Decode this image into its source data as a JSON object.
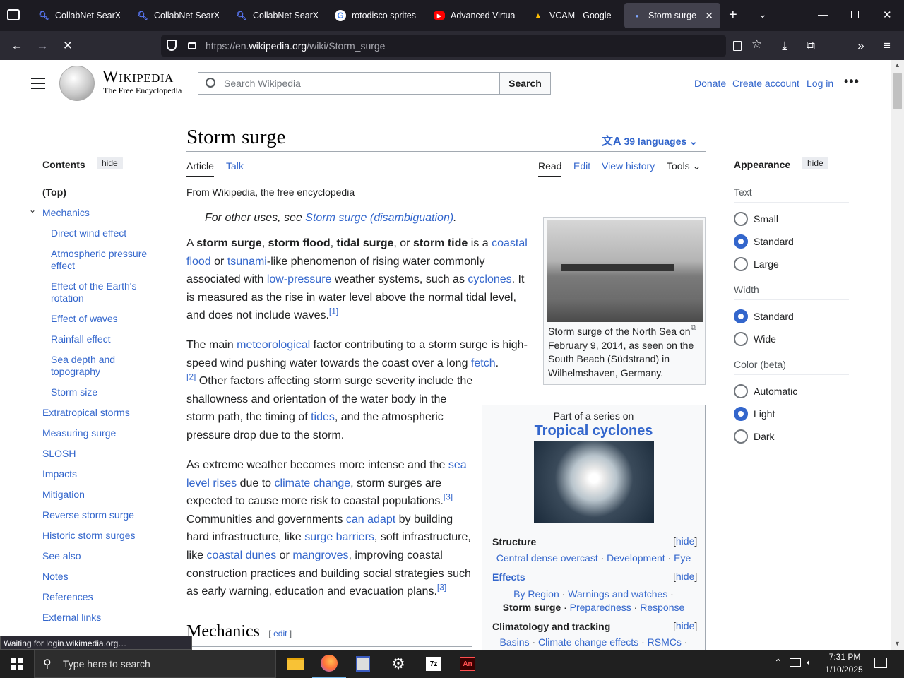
{
  "tabs": [
    {
      "title": "CollabNet SearXNG",
      "icon": "search-icon"
    },
    {
      "title": "CollabNet SearXNG",
      "icon": "search-icon"
    },
    {
      "title": "CollabNet SearXNG",
      "icon": "search-icon"
    },
    {
      "title": "rotodisco sprites s",
      "icon": "google-icon"
    },
    {
      "title": "Advanced Virtual C",
      "icon": "youtube-icon"
    },
    {
      "title": "VCAM - Google Dr",
      "icon": "google-drive-icon"
    },
    {
      "title": "Storm surge - W",
      "icon": "loading-icon"
    }
  ],
  "url": {
    "prefix": "https://en.",
    "domain": "wikipedia.org",
    "path": "/wiki/Storm_surge"
  },
  "status_text": "Waiting for login.wikimedia.org…",
  "wiki": {
    "logo_title": "Wikipedia",
    "logo_tagline": "The Free Encyclopedia",
    "search_placeholder": "Search Wikipedia",
    "search_button": "Search",
    "header_links": [
      "Donate",
      "Create account",
      "Log in"
    ],
    "title": "Storm surge",
    "languages": "39 languages",
    "tabs_left": [
      "Article",
      "Talk"
    ],
    "tabs_right": [
      "Read",
      "Edit",
      "View history",
      "Tools"
    ],
    "from": "From Wikipedia, the free encyclopedia",
    "hatnote_prefix": "For other uses, see ",
    "hatnote_link": "Storm surge (disambiguation)",
    "hatnote_suffix": ".",
    "contents_title": "Contents",
    "hide": "hide",
    "contents": [
      {
        "label": "(Top)",
        "level": 0
      },
      {
        "label": "Mechanics",
        "level": 0
      },
      {
        "label": "Direct wind effect",
        "level": 1
      },
      {
        "label": "Atmospheric pressure effect",
        "level": 1
      },
      {
        "label": "Effect of the Earth's rotation",
        "level": 1
      },
      {
        "label": "Effect of waves",
        "level": 1
      },
      {
        "label": "Rainfall effect",
        "level": 1
      },
      {
        "label": "Sea depth and topography",
        "level": 1
      },
      {
        "label": "Storm size",
        "level": 1
      },
      {
        "label": "Extratropical storms",
        "level": 0
      },
      {
        "label": "Measuring surge",
        "level": 0
      },
      {
        "label": "SLOSH",
        "level": 0
      },
      {
        "label": "Impacts",
        "level": 0
      },
      {
        "label": "Mitigation",
        "level": 0
      },
      {
        "label": "Reverse storm surge",
        "level": 0
      },
      {
        "label": "Historic storm surges",
        "level": 0
      },
      {
        "label": "See also",
        "level": 0
      },
      {
        "label": "Notes",
        "level": 0
      },
      {
        "label": "References",
        "level": 0
      },
      {
        "label": "External links",
        "level": 0
      }
    ],
    "appearance": {
      "title": "Appearance",
      "text_label": "Text",
      "text_options": [
        "Small",
        "Standard",
        "Large"
      ],
      "width_label": "Width",
      "width_options": [
        "Standard",
        "Wide"
      ],
      "color_label": "Color (beta)",
      "color_options": [
        "Automatic",
        "Light",
        "Dark"
      ]
    },
    "p1": {
      "a": "A ",
      "b1": "storm surge",
      "c": ", ",
      "b2": "storm flood",
      "d": ", ",
      "b3": "tidal surge",
      "e": ", or ",
      "b4": "storm tide",
      "f": " is a ",
      "l1": "coastal flood",
      "g": " or ",
      "l2": "tsunami",
      "h": "-like phenomenon of rising water commonly associated with ",
      "l3": "low-pressure",
      "i": " weather systems, such as ",
      "l4": "cyclones",
      "j": ". It is measured as the rise in water level above the normal tidal level, and does not include waves.",
      "r1": "[1]"
    },
    "p2": {
      "a": "The main ",
      "l1": "meteorological",
      "b": " factor contributing to a storm surge is high-speed wind pushing water towards the coast over a long ",
      "l2": "fetch",
      "c": ".",
      "r2": "[2]",
      "d": " Other factors affecting storm surge severity include the shallowness and orientation of the water body in the storm path, the timing of ",
      "l3": "tides",
      "e": ", and the atmospheric pressure drop due to the storm."
    },
    "p3": {
      "a": "As extreme weather becomes more intense and the ",
      "l1": "sea level rises",
      "b": " due to ",
      "l2": "climate change",
      "c": ", storm surges are expected to cause more risk to coastal populations.",
      "r3": "[3]",
      "d": " Communities and governments ",
      "l3": "can adapt",
      "e": " by building hard infrastructure, like ",
      "l4": "surge barriers",
      "f": ", soft infrastructure, like ",
      "l5": "coastal dunes",
      "g": " or ",
      "l6": "mangroves",
      "h": ", improving coastal construction practices and building social strategies such as early warning, education and evacuation plans.",
      "r4": "[3]"
    },
    "mechanics_heading": "Mechanics",
    "edit": "edit",
    "image_caption": "Storm surge of the North Sea on February 9, 2014, as seen on the South Beach (Südstrand) in Wilhelmshaven, Germany.",
    "series": {
      "part": "Part of a series on",
      "title": "Tropical cyclones",
      "hide": "hide",
      "structure": "Structure",
      "structure_links": [
        "Central dense overcast",
        "Development",
        "Eye"
      ],
      "effects": "Effects",
      "effects_links": [
        "By Region",
        "Warnings and watches"
      ],
      "effects_bold": "Storm surge",
      "effects_links2": [
        "Preparedness",
        "Response"
      ],
      "clim": "Climatology and tracking",
      "clim_links": [
        "Basins",
        "Climate change effects",
        "RSMCs"
      ]
    }
  },
  "taskbar": {
    "search_placeholder": "Type here to search",
    "time": "7:31 PM",
    "date": "1/10/2025"
  }
}
